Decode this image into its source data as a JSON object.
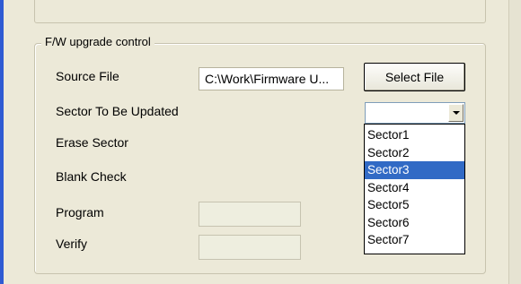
{
  "group": {
    "legend": "F/W upgrade control"
  },
  "rows": {
    "source_file_label": "Source File",
    "sector_label": "Sector To Be Updated",
    "erase_label": "Erase Sector",
    "blank_label": "Blank Check",
    "program_label": "Program",
    "verify_label": "Verify"
  },
  "source_file": {
    "value": "C:\\Work\\Firmware U..."
  },
  "select_button": {
    "label": "Select File"
  },
  "sector_combo": {
    "selected": "",
    "icon": "chevron-down-icon"
  },
  "dropdown": {
    "options": [
      "Sector1",
      "Sector2",
      "Sector3",
      "Sector4",
      "Sector5",
      "Sector6",
      "Sector7"
    ],
    "highlighted": "Sector3"
  },
  "colors": {
    "window": "#ece9d8",
    "accent": "#2f5bd3",
    "selection": "#316ac5"
  }
}
